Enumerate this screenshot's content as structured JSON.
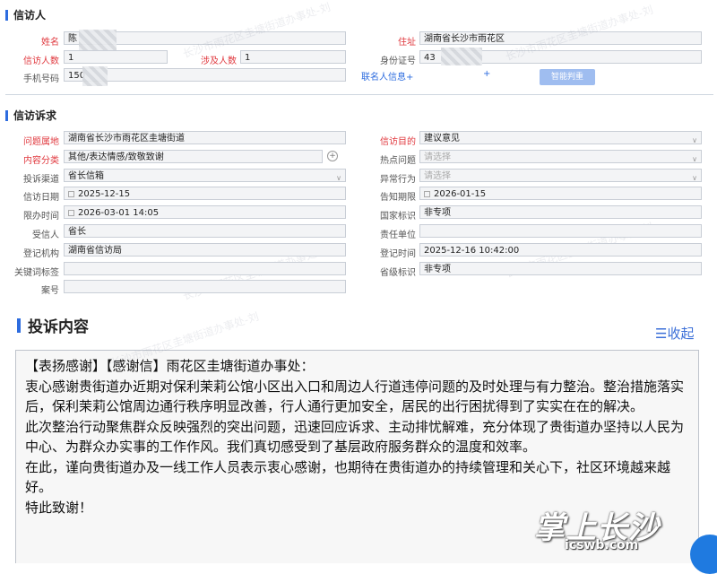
{
  "petitioner": {
    "title": "信访人",
    "name_label": "姓名",
    "name_value": "陈",
    "address_label": "住址",
    "address_value": "湖南省长沙市雨花区",
    "count_label": "信访人数",
    "count_value": "1",
    "involved_label": "涉及人数",
    "involved_value": "1",
    "id_label": "身份证号",
    "id_value": "43",
    "phone_label": "手机号码",
    "phone_value": "150",
    "contact_link": "联名人信息+",
    "plus_link": "+",
    "smart_button": "智能判重"
  },
  "appeal": {
    "title": "信访诉求",
    "left": [
      {
        "label": "问题属地",
        "value": "湖南省长沙市雨花区圭塘街道",
        "required": true,
        "kind": "text"
      },
      {
        "label": "内容分类",
        "value": "其他/表达情感/致敬致谢",
        "required": true,
        "kind": "class"
      },
      {
        "label": "投诉渠道",
        "value": "省长信箱",
        "required": false,
        "kind": "select"
      },
      {
        "label": "信访日期",
        "value": "2025-12-15",
        "required": false,
        "kind": "date"
      },
      {
        "label": "限办时间",
        "value": "2026-03-01 14:05",
        "required": false,
        "kind": "date"
      },
      {
        "label": "受信人",
        "value": "省长",
        "required": false,
        "kind": "text"
      },
      {
        "label": "登记机构",
        "value": "湖南省信访局",
        "required": false,
        "kind": "text"
      },
      {
        "label": "关键词标签",
        "value": "",
        "required": false,
        "kind": "text"
      },
      {
        "label": "案号",
        "value": "",
        "required": false,
        "kind": "text"
      }
    ],
    "right": [
      {
        "label": "信访目的",
        "value": "建议意见",
        "required": true,
        "kind": "select"
      },
      {
        "label": "热点问题",
        "value": "请选择",
        "required": false,
        "kind": "placeholder"
      },
      {
        "label": "异常行为",
        "value": "请选择",
        "required": false,
        "kind": "placeholder"
      },
      {
        "label": "告知期限",
        "value": "2026-01-15",
        "required": false,
        "kind": "date"
      },
      {
        "label": "国家标识",
        "value": "非专项",
        "required": false,
        "kind": "text"
      },
      {
        "label": "责任单位",
        "value": "",
        "required": false,
        "kind": "text"
      },
      {
        "label": "登记时间",
        "value": "2025-12-16 10:42:00",
        "required": false,
        "kind": "text"
      },
      {
        "label": "省级标识",
        "value": "非专项",
        "required": false,
        "kind": "text"
      }
    ]
  },
  "complaint": {
    "title": "投诉内容",
    "collapse_label": "收起",
    "paragraphs": [
      "【表扬感谢】【感谢信】雨花区圭塘街道办事处：",
      "衷心感谢贵街道办近期对保利茉莉公馆小区出入口和周边人行道违停问题的及时处理与有力整治。整治措施落实后，保利茉莉公馆周边通行秩序明显改善，行人通行更加安全，居民的出行困扰得到了实实在在的解决。",
      "此次整治行动聚焦群众反映强烈的突出问题，迅速回应诉求、主动排忧解难，充分体现了贵街道办坚持以人民为中心、为群众办实事的工作作风。我们真切感受到了基层政府服务群众的温度和效率。",
      "在此，谨向贵街道办及一线工作人员表示衷心感谢，也期待在贵街道办的持续管理和关心下，社区环境越来越好。",
      "特此致谢！"
    ]
  },
  "watermark": {
    "text": "长沙市雨花区圭塘街道办事处-刘"
  },
  "logo": {
    "main": "掌上长沙",
    "sub": "icswb.com"
  },
  "colors": {
    "accent": "#2d6cdf",
    "required_label": "#e0383e",
    "field_bg": "#f3f4f6"
  }
}
